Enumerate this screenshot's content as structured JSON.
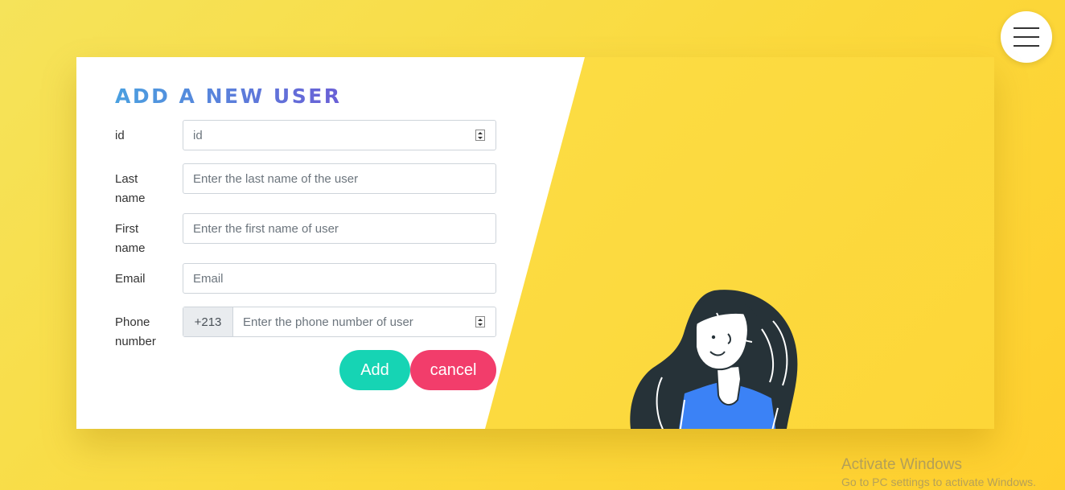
{
  "menu": {
    "icon": "hamburger-menu-icon"
  },
  "form": {
    "title": "ADD A NEW USER",
    "fields": {
      "id": {
        "label": "id",
        "placeholder": "id"
      },
      "last_name": {
        "label": "Last name",
        "placeholder": "Enter the last name of the user"
      },
      "first_name": {
        "label": "First name",
        "placeholder": "Enter the first name of user"
      },
      "email": {
        "label": "Email",
        "placeholder": "Email"
      },
      "phone": {
        "label": "Phone number",
        "prefix": "+213",
        "placeholder": "Enter the phone number of user"
      }
    },
    "buttons": {
      "add": "Add",
      "cancel": "cancel"
    }
  },
  "watermark": {
    "line1": "Activate Windows",
    "line2": "Go to PC settings to activate Windows."
  },
  "colors": {
    "background": "#fbd93c",
    "title_gradient_start": "#4aa0e0",
    "title_gradient_end": "#6a5fd6",
    "add_button": "#16d4b4",
    "cancel_button": "#f23d6b"
  }
}
